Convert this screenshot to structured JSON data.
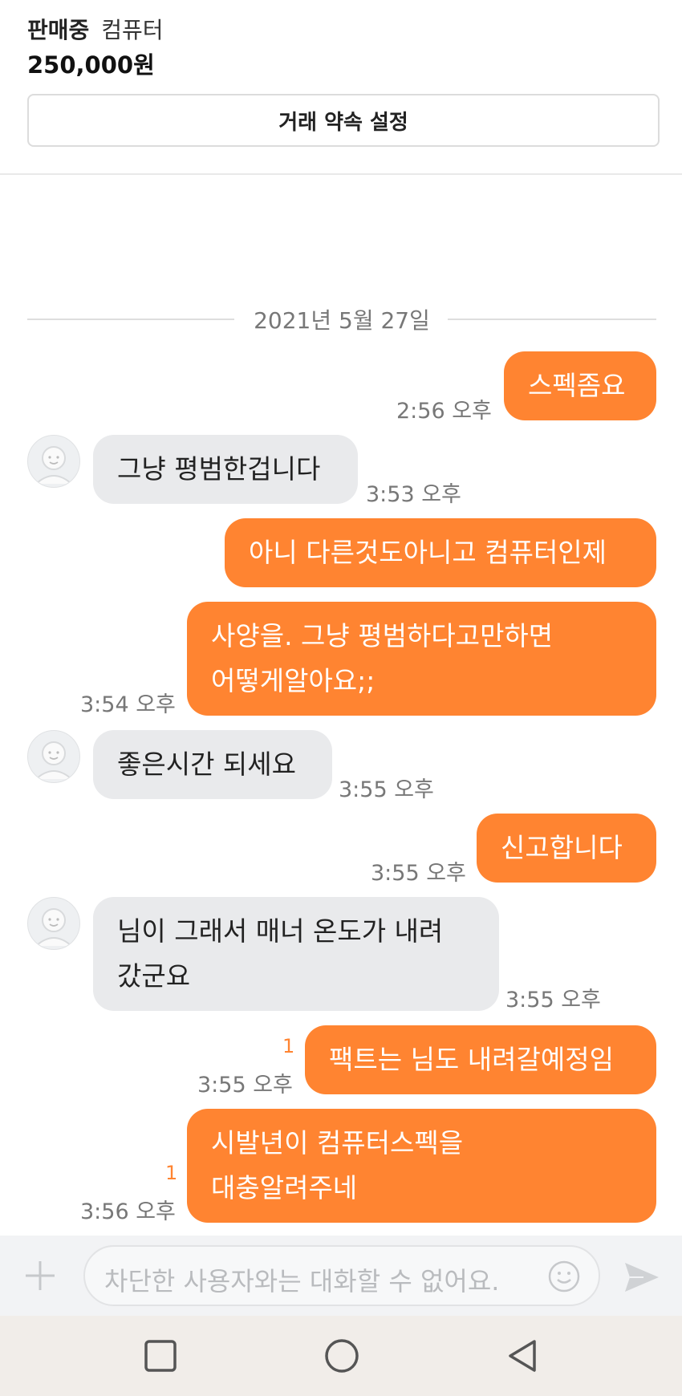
{
  "header": {
    "status": "판매중",
    "product_title": "컴퓨터",
    "price": "250,000원",
    "appointment_button": "거래 약속 설정"
  },
  "chat": {
    "date": "2021년 5월 27일",
    "messages": [
      {
        "sender": "me",
        "text": "스펙좀요",
        "time": "2:56 오후"
      },
      {
        "sender": "other",
        "text": "그냥 평범한겁니다",
        "time": "3:53 오후"
      },
      {
        "sender": "me",
        "text": "아니 다른것도아니고 컴퓨터인제",
        "time": ""
      },
      {
        "sender": "me",
        "lines": [
          "사양을. 그냥 평범하다고만하면",
          "어떻게알아요;;"
        ],
        "time": "3:54 오후"
      },
      {
        "sender": "other",
        "text": "좋은시간 되세요",
        "time": "3:55 오후"
      },
      {
        "sender": "me",
        "text": "신고합니다",
        "time": "3:55 오후"
      },
      {
        "sender": "other",
        "lines": [
          "님이 그래서 매너 온도가 내려",
          "갔군요"
        ],
        "time": "3:55 오후"
      },
      {
        "sender": "me",
        "text": "팩트는 님도 내려갈예정임",
        "time": "3:55 오후",
        "unread": "1"
      },
      {
        "sender": "me",
        "lines": [
          "시발년이 컴퓨터스펙을",
          "대충알려주네"
        ],
        "time": "3:56 오후",
        "unread": "1"
      }
    ]
  },
  "input": {
    "placeholder": "차단한 사용자와는 대화할 수 없어요."
  },
  "icons": {
    "plus": "plus-icon",
    "emoji": "emoji-icon",
    "send": "send-icon",
    "nav_recent": "square-icon",
    "nav_home": "circle-icon",
    "nav_back": "triangle-back-icon"
  },
  "colors": {
    "accent": "#ff8431",
    "bubble_other": "#e9eaec",
    "nav_bg": "#f1ede9"
  }
}
